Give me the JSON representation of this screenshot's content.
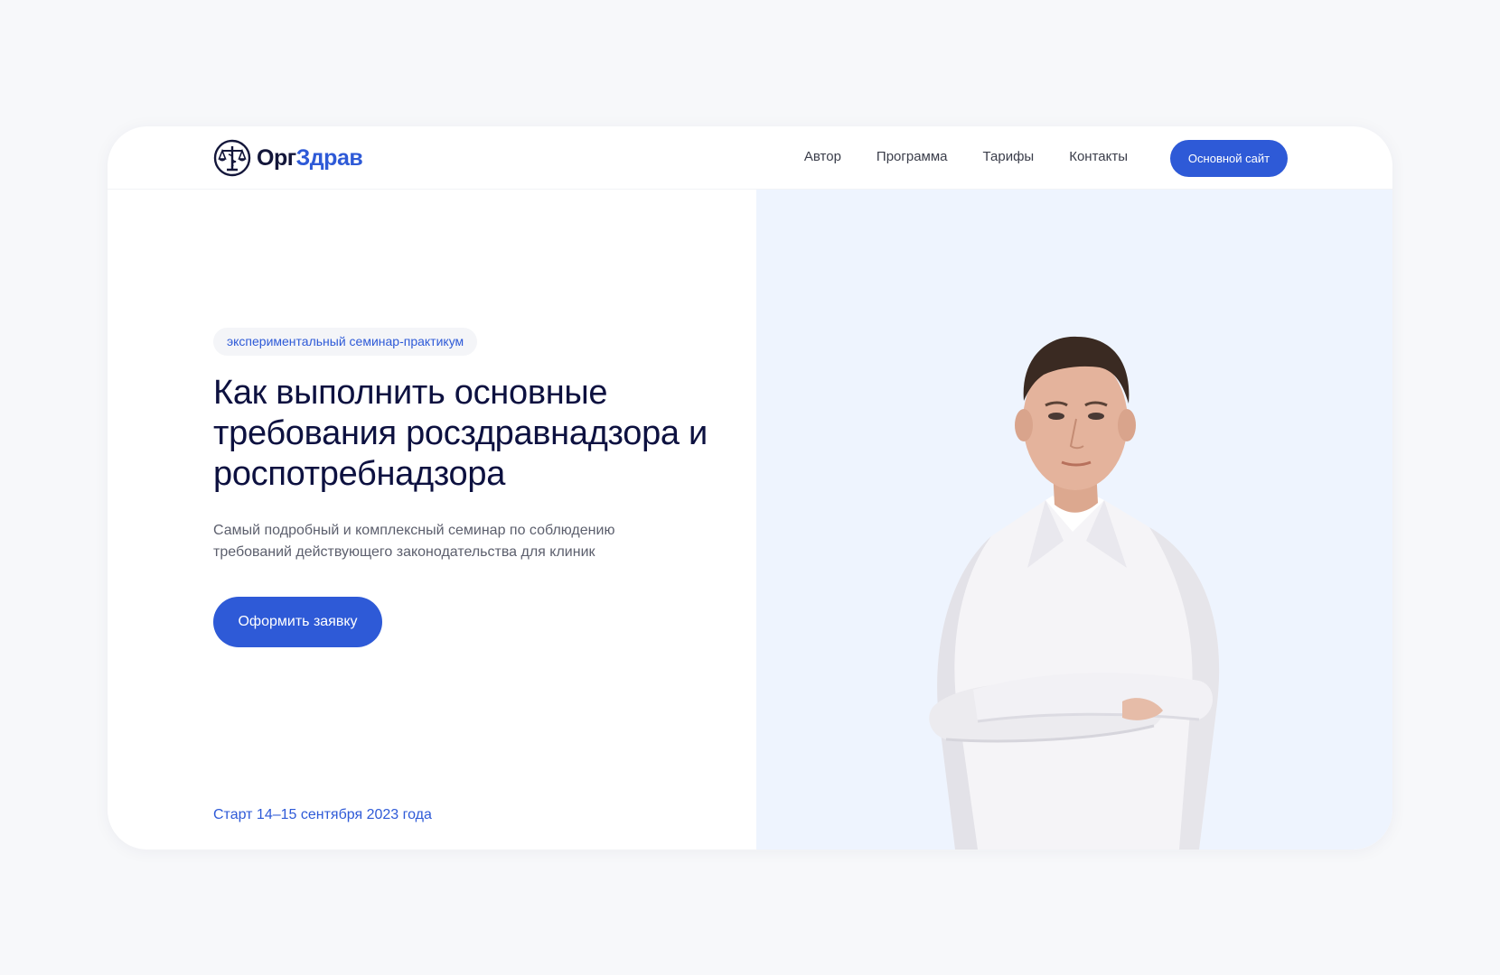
{
  "header": {
    "logo_part1": "Орг",
    "logo_part2": "Здрав",
    "nav": [
      "Автор",
      "Программа",
      "Тарифы",
      "Контакты"
    ],
    "main_site_label": "Основной сайт"
  },
  "hero": {
    "badge": "экспериментальный семинар-практикум",
    "title": "Как выполнить основные требования росздравнадзора и роспотребнадзора",
    "subtitle": "Самый подробный и комплексный семинар по соблюдению требований действующего законодательства для клиник",
    "cta_label": "Оформить заявку",
    "start_date": "Старт 14–15 сентября 2023 года"
  },
  "colors": {
    "accent": "#2e5ad7",
    "heading": "#0d1140",
    "panel": "#eef4fe",
    "page_bg": "#f7f8fa"
  },
  "icons": {
    "logo": "scales-caduceus-emblem"
  }
}
